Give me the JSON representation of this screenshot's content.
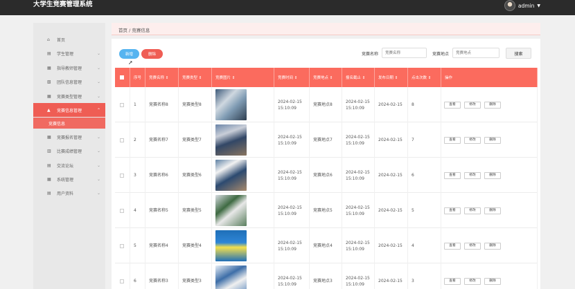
{
  "app": {
    "title": "大学生竞赛管理系统"
  },
  "user": {
    "name": "admin"
  },
  "sidebar": {
    "items": [
      {
        "icon": "⌂",
        "label": "首页",
        "chevron": false,
        "active": false
      },
      {
        "icon": "▤",
        "label": "学生管理",
        "chevron": true,
        "active": false
      },
      {
        "icon": "▦",
        "label": "指导教师管理",
        "chevron": true,
        "active": false
      },
      {
        "icon": "▧",
        "label": "团队信息管理",
        "chevron": true,
        "active": false
      },
      {
        "icon": "▦",
        "label": "竞赛类型管理",
        "chevron": true,
        "active": false
      },
      {
        "icon": "▲",
        "label": "竞赛信息管理",
        "chevron": true,
        "active": true
      },
      {
        "icon": "▦",
        "label": "竞赛报名管理",
        "chevron": true,
        "active": false
      },
      {
        "icon": "▥",
        "label": "比赛成绩管理",
        "chevron": true,
        "active": false
      },
      {
        "icon": "▤",
        "label": "交流论坛",
        "chevron": true,
        "active": false
      },
      {
        "icon": "▦",
        "label": "系统管理",
        "chevron": true,
        "active": false
      },
      {
        "icon": "▤",
        "label": "用户资料",
        "chevron": true,
        "active": false
      }
    ],
    "sub_item": "竞赛信息"
  },
  "breadcrumb": "首页 / 竞赛信息",
  "toolbar": {
    "add_label": "新增",
    "delete_label": "删除"
  },
  "filters": {
    "name_label": "竞赛名称",
    "name_placeholder": "竞赛名称",
    "location_label": "竞赛地点",
    "location_placeholder": "竞赛地点",
    "search_label": "搜索"
  },
  "table": {
    "headers": [
      "",
      "序号",
      "竞赛名称 ⇕",
      "竞赛类型 ⇕",
      "竞赛图片 ⇕",
      "竞赛时间 ⇕",
      "竞赛地点 ⇕",
      "报名截止 ⇕",
      "发布日期 ⇕",
      "点击次数 ⇕",
      "操作"
    ],
    "rows": [
      {
        "index": "1",
        "name": "竞赛名称8",
        "type": "竞赛类型8",
        "time": "2024-02-15 15:10:09",
        "location": "竞赛地点8",
        "deadline": "2024-02-15 15:10:09",
        "publish": "2024-02-15",
        "clicks": "8"
      },
      {
        "index": "2",
        "name": "竞赛名称7",
        "type": "竞赛类型7",
        "time": "2024-02-15 15:10:09",
        "location": "竞赛地点7",
        "deadline": "2024-02-15 15:10:09",
        "publish": "2024-02-15",
        "clicks": "7"
      },
      {
        "index": "3",
        "name": "竞赛名称6",
        "type": "竞赛类型6",
        "time": "2024-02-15 15:10:09",
        "location": "竞赛地点6",
        "deadline": "2024-02-15 15:10:09",
        "publish": "2024-02-15",
        "clicks": "6"
      },
      {
        "index": "4",
        "name": "竞赛名称5",
        "type": "竞赛类型5",
        "time": "2024-02-15 15:10:09",
        "location": "竞赛地点5",
        "deadline": "2024-02-15 15:10:09",
        "publish": "2024-02-15",
        "clicks": "5"
      },
      {
        "index": "5",
        "name": "竞赛名称4",
        "type": "竞赛类型4",
        "time": "2024-02-15 15:10:09",
        "location": "竞赛地点4",
        "deadline": "2024-02-15 15:10:09",
        "publish": "2024-02-15",
        "clicks": "4"
      },
      {
        "index": "6",
        "name": "竞赛名称3",
        "type": "竞赛类型3",
        "time": "2024-02-15 15:10:09",
        "location": "竞赛地点3",
        "deadline": "2024-02-15 15:10:09",
        "publish": "2024-02-15",
        "clicks": "3"
      }
    ],
    "actions": {
      "view": "查看",
      "edit": "修改",
      "delete": "删除"
    }
  },
  "colors": {
    "accent": "#ef5d54",
    "header_bg": "#fb6b5e",
    "add_button": "#56b4f0",
    "topbar": "#2b2b2b"
  }
}
